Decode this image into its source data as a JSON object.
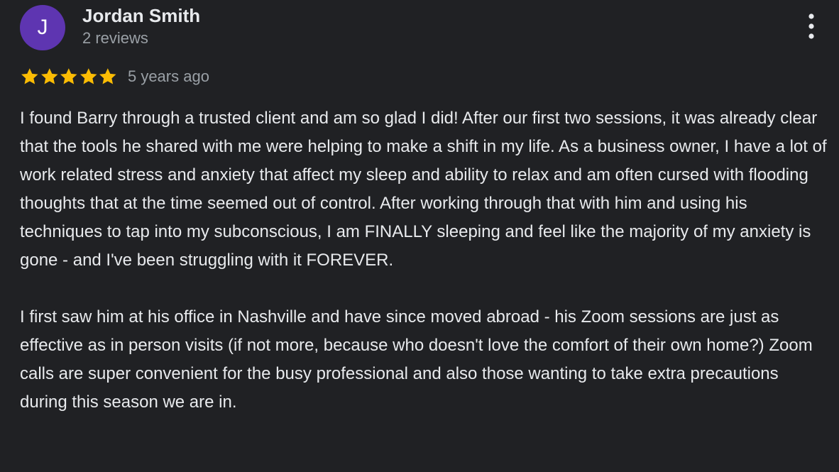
{
  "reviewer": {
    "initial": "J",
    "name": "Jordan Smith",
    "review_count": "2 reviews",
    "avatar_color": "#5e35b1"
  },
  "rating": {
    "stars": 5,
    "max_stars": 5,
    "star_color": "#fbbc04",
    "time_ago": "5 years ago"
  },
  "review": {
    "paragraphs": [
      "I found Barry through a trusted client and am so glad I did! After our first two sessions, it was already clear that the tools he shared with me were helping to make a shift in my life. As a business owner, I have a lot of work related stress and anxiety that affect my sleep and ability to relax and am often cursed with flooding thoughts that at the time seemed out of control. After working through that with him and using his techniques to tap into my subconscious, I am FINALLY sleeping and feel like the majority of my anxiety is gone - and I've been struggling with it FOREVER.",
      "I first saw him at his office in Nashville and have since moved abroad - his Zoom sessions are just as effective as in person visits (if not more, because who doesn't love the comfort of their own home?) Zoom calls are super convenient for the busy professional and also those wanting to take extra precautions during this season we are in."
    ]
  },
  "menu": {
    "icon": "more-vert-icon"
  }
}
